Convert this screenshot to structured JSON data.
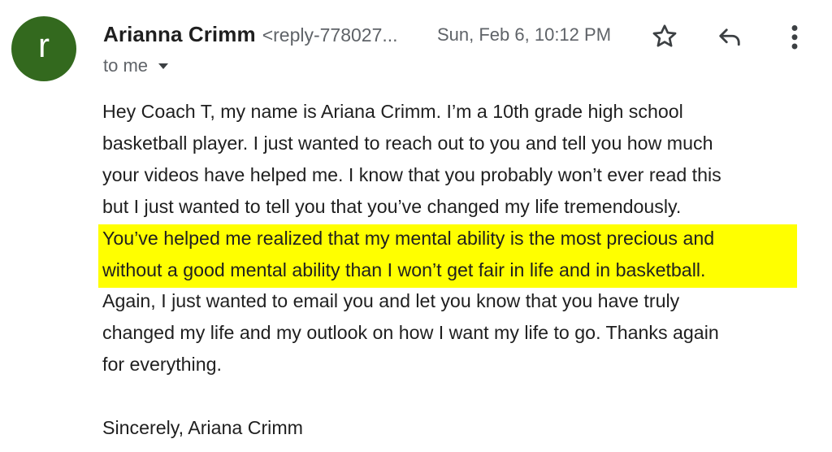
{
  "sender": {
    "avatar_letter": "r",
    "avatar_color": "#33691e",
    "name": "Arianna Crimm",
    "email_truncated": "<reply-778027..."
  },
  "timestamp": "Sun, Feb 6, 10:12 PM",
  "recipient_label": "to me",
  "actions": {
    "star_icon": "star-outline-icon",
    "reply_icon": "reply-arrow-icon",
    "more_icon": "more-vertical-icon"
  },
  "body": {
    "lines": [
      "Hey Coach T, my name is Ariana Crimm. I’m a 10th grade high school",
      "basketball player. I just wanted to reach out to you and tell you how much",
      "your videos have helped me. I know that you probably won’t ever read this",
      "but I just wanted to tell you that you’ve changed my life tremendously.",
      "You’ve helped me realized that my mental ability is the most precious and",
      "without a good mental ability than I won’t get fair in life and in basketball.",
      "Again, I just wanted to email you and let you know that you have truly",
      "changed my life and my outlook on how I want my life to go. Thanks again",
      "for everything."
    ],
    "highlight_color": "#ffff00",
    "signoff": "Sincerely, Ariana Crimm"
  }
}
